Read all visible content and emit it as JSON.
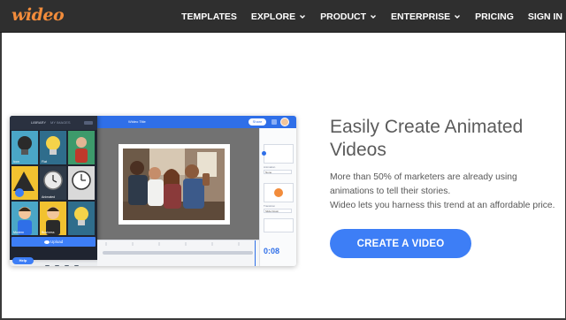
{
  "header": {
    "logo": "wideo",
    "nav": [
      {
        "label": "TEMPLATES",
        "dropdown": false
      },
      {
        "label": "EXPLORE",
        "dropdown": true
      },
      {
        "label": "PRODUCT",
        "dropdown": true
      },
      {
        "label": "ENTERPRISE",
        "dropdown": true
      },
      {
        "label": "PRICING",
        "dropdown": false
      },
      {
        "label": "SIGN IN",
        "dropdown": false
      }
    ]
  },
  "hero": {
    "title": "Easily Create Animated Videos",
    "body_line1": "More than 50% of marketers are already using animations to tell their stories.",
    "body_line2": "Wideo lets you harness this trend at an affordable price.",
    "cta_label": "CREATE A VIDEO"
  },
  "editor": {
    "library_tab": "LIBRARY",
    "library_tab2": "MY IMAGES",
    "tiles": [
      "Icon",
      "Flat",
      "",
      "",
      "Animated",
      "",
      "Modern",
      "Business",
      ""
    ],
    "upload_label": "Upload",
    "help_label": "Help",
    "video_title": "Wideo Title",
    "share_label": "Share",
    "time_display": "0:08",
    "panel_label_1": "Animation",
    "panel_select_1": "None",
    "panel_label_2": "Transition",
    "panel_select_2": "Slide Down"
  },
  "colors": {
    "nav_bg": "#2f2f2f",
    "logo": "#f28c3b",
    "accent": "#3d7ef6",
    "text": "#5b5b5b"
  },
  "icons": [
    "chevron-down-icon",
    "cloud-upload-icon",
    "search-icon"
  ]
}
